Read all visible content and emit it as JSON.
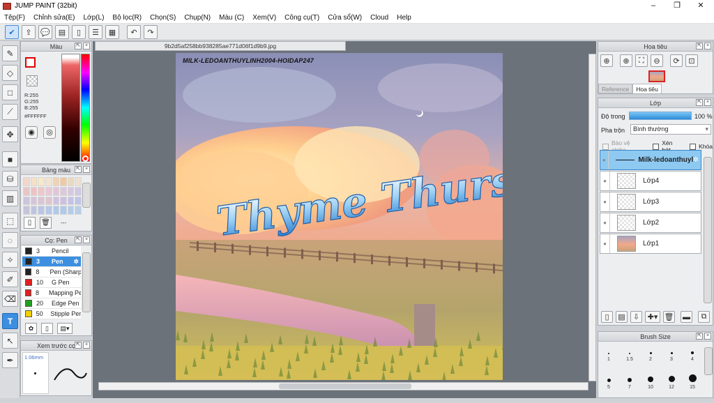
{
  "window": {
    "title": "JUMP PAINT (32bit)",
    "controls": [
      "–",
      "❐",
      "✕"
    ]
  },
  "menu": [
    "Tệp(F)",
    "Chỉnh sửa(E)",
    "Lớp(L)",
    "Bộ lọc(R)",
    "Chọn(S)",
    "Chụp(N)",
    "Màu (C)",
    "Xem(V)",
    "Công cụ(T)",
    "Cửa sổ(W)",
    "Cloud",
    "Help"
  ],
  "document": {
    "filename": "9b2d5af258bb938285ae771d06f1d9b9.jpg",
    "watermark": "MILK-LEDOANTHUYLINH2004-HOIDAP247",
    "lettering": "Thyme Thursday"
  },
  "color_panel": {
    "title": "Màu",
    "r": "R:255",
    "g": "G:255",
    "b": "B:255",
    "hex": "#FFFFFF"
  },
  "palette_panel": {
    "title": "Bảng màu",
    "dash": "---"
  },
  "brush_panel": {
    "title": "Cọ: Pen",
    "items": [
      {
        "size": "3",
        "name": "Pencil",
        "color": "#222222"
      },
      {
        "size": "3",
        "name": "Pen",
        "color": "#222222",
        "selected": true
      },
      {
        "size": "8",
        "name": "Pen (Sharp)",
        "color": "#222222"
      },
      {
        "size": "10",
        "name": "G Pen",
        "color": "#e02020"
      },
      {
        "size": "8",
        "name": "Mapping Pen",
        "color": "#e02020"
      },
      {
        "size": "20",
        "name": "Edge Pen",
        "color": "#20a020"
      },
      {
        "size": "50",
        "name": "Stipple Pen",
        "color": "#f0d000"
      }
    ]
  },
  "preview_panel": {
    "title": "Xem trước cọ",
    "size": "1.06mm"
  },
  "navigator": {
    "title": "Hoa tiêu",
    "tabs": [
      "Reference",
      "Hoa tiêu"
    ]
  },
  "layer_panel": {
    "title": "Lớp",
    "opacity_label": "Độ trong",
    "opacity_value": "100 %",
    "opacity_fraction": 1.0,
    "blend_label": "Pha trộn",
    "blend_value": "Bình thường",
    "opt_alpha": "Bảo vệ alpha",
    "opt_clip": "Xén bớt",
    "opt_lock": "Khóa",
    "layers": [
      {
        "name": "Milk-ledoanthuylinh",
        "selected": true
      },
      {
        "name": "Lớp4"
      },
      {
        "name": "Lớp3"
      },
      {
        "name": "Lớp2"
      },
      {
        "name": "Lớp1"
      }
    ]
  },
  "brush_size_panel": {
    "title": "Brush Size",
    "row1": [
      "1",
      "1.5",
      "2",
      "3",
      "4"
    ],
    "row2": [
      "5",
      "7",
      "10",
      "12",
      "15"
    ]
  },
  "colors": {
    "accent": "#3c8fe0",
    "selection": "#8ec9f2",
    "workspace": "#6c727a"
  }
}
